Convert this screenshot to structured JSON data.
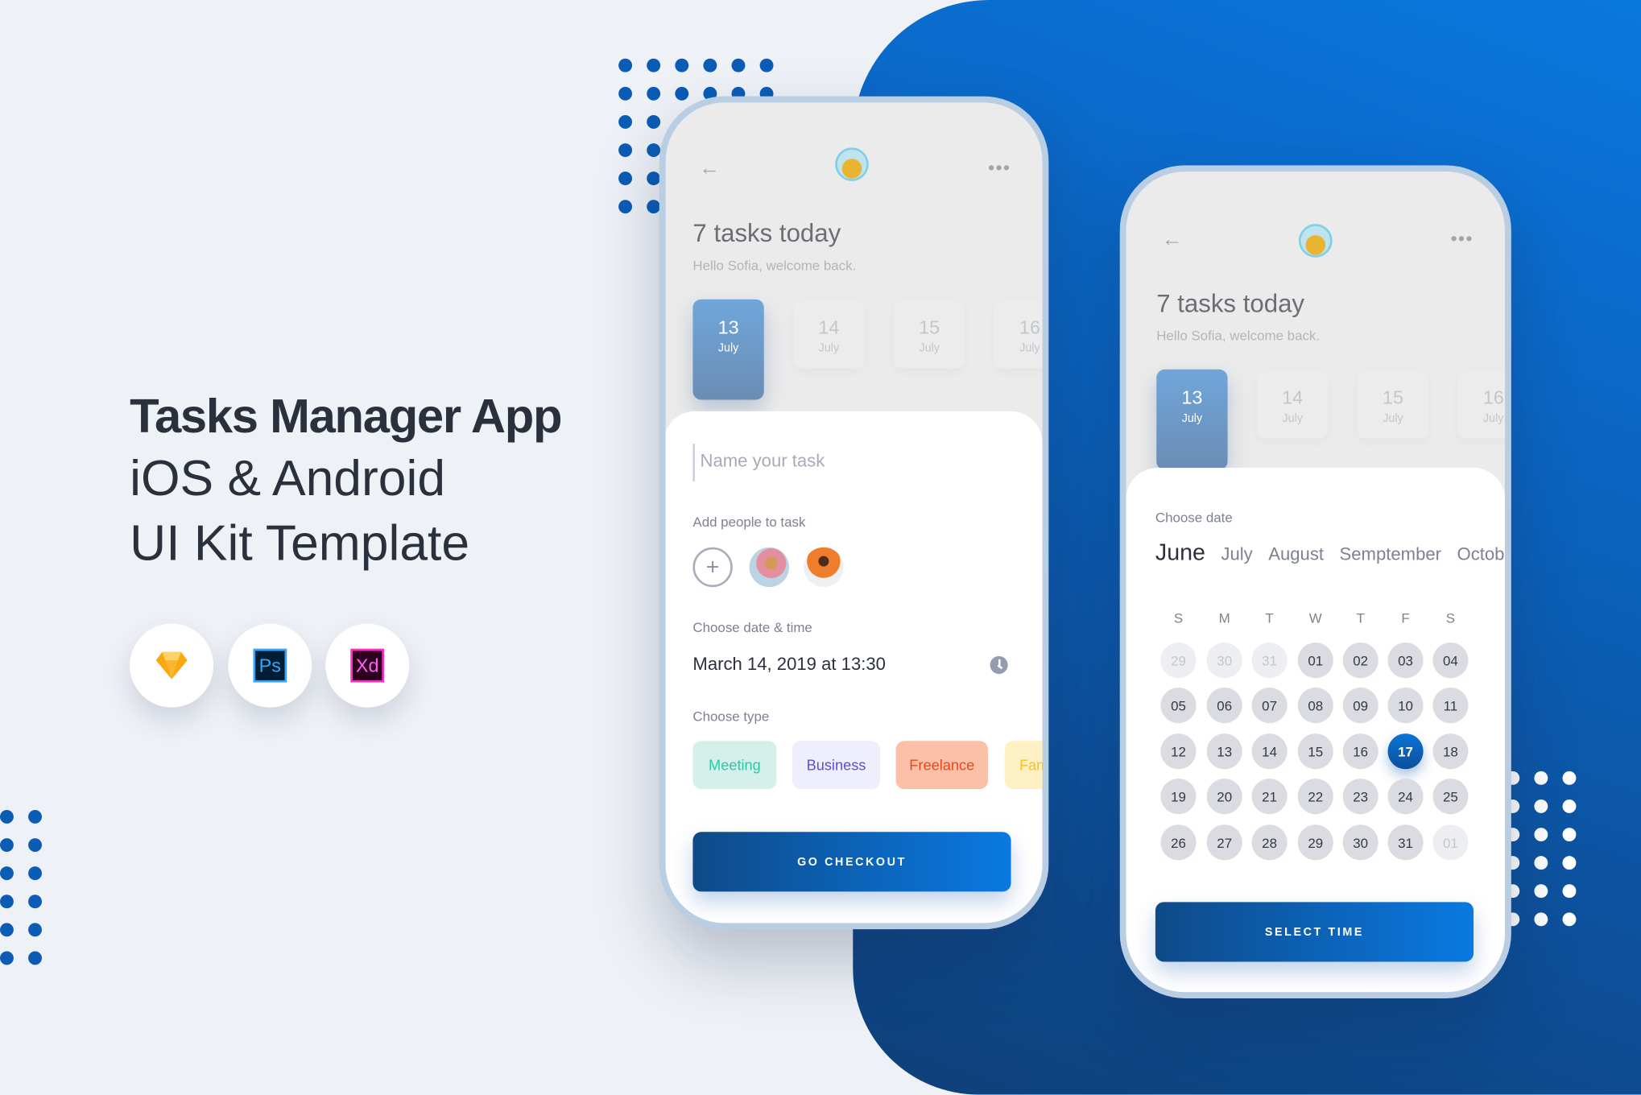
{
  "hero": {
    "title": "Tasks Manager App",
    "line2": "iOS & Android",
    "line3": "UI Kit Template"
  },
  "tools": [
    {
      "icon": "sketch-icon",
      "label": ""
    },
    {
      "icon": "photoshop-icon",
      "label": "Ps"
    },
    {
      "icon": "xd-icon",
      "label": "Xd"
    }
  ],
  "colors": {
    "accent": "#0a74d8",
    "accent_dark": "#0e4a88",
    "bg": "#eef1f6"
  },
  "phone1": {
    "title": "7 tasks today",
    "subtitle": "Hello Sofia, welcome back.",
    "dates": [
      {
        "day": "13",
        "month": "July",
        "selected": true
      },
      {
        "day": "14",
        "month": "July"
      },
      {
        "day": "15",
        "month": "July"
      },
      {
        "day": "16",
        "month": "July"
      }
    ],
    "task_placeholder": "Name your task",
    "people_label": "Add people to task",
    "datetime_label": "Choose date & time",
    "datetime_value": "March 14, 2019 at 13:30",
    "type_label": "Choose type",
    "types": [
      {
        "label": "Meeting",
        "bg": "#d5f0ea",
        "color": "#2bc9a0"
      },
      {
        "label": "Business",
        "bg": "#eeeefc",
        "color": "#5b4fd9"
      },
      {
        "label": "Freelance",
        "bg": "#fbc0a8",
        "color": "#e8491d"
      },
      {
        "label": "Family",
        "bg": "#fdf1c4",
        "color": "#f2c12e"
      }
    ],
    "button": "GO CHECKOUT"
  },
  "phone2": {
    "title": "7 tasks today",
    "subtitle": "Hello Sofia, welcome back.",
    "dates": [
      {
        "day": "13",
        "month": "July",
        "selected": true
      },
      {
        "day": "14",
        "month": "July"
      },
      {
        "day": "15",
        "month": "July"
      },
      {
        "day": "16",
        "month": "July"
      }
    ],
    "date_label": "Choose date",
    "months": [
      "June",
      "July",
      "August",
      "Semptember",
      "October"
    ],
    "active_month": "June",
    "weekdays": [
      "S",
      "M",
      "T",
      "W",
      "T",
      "F",
      "S"
    ],
    "days": [
      [
        "29",
        "30",
        "31",
        "01",
        "02",
        "03",
        "04"
      ],
      [
        "05",
        "06",
        "07",
        "08",
        "09",
        "10",
        "11"
      ],
      [
        "12",
        "13",
        "14",
        "15",
        "16",
        "17",
        "18"
      ],
      [
        "19",
        "20",
        "21",
        "22",
        "23",
        "24",
        "25"
      ],
      [
        "26",
        "27",
        "28",
        "29",
        "30",
        "31",
        "01"
      ]
    ],
    "muted_days": [
      [
        0,
        0
      ],
      [
        0,
        1
      ],
      [
        0,
        2
      ],
      [
        4,
        6
      ]
    ],
    "selected_day": "17",
    "button": "SELECT TIME"
  }
}
